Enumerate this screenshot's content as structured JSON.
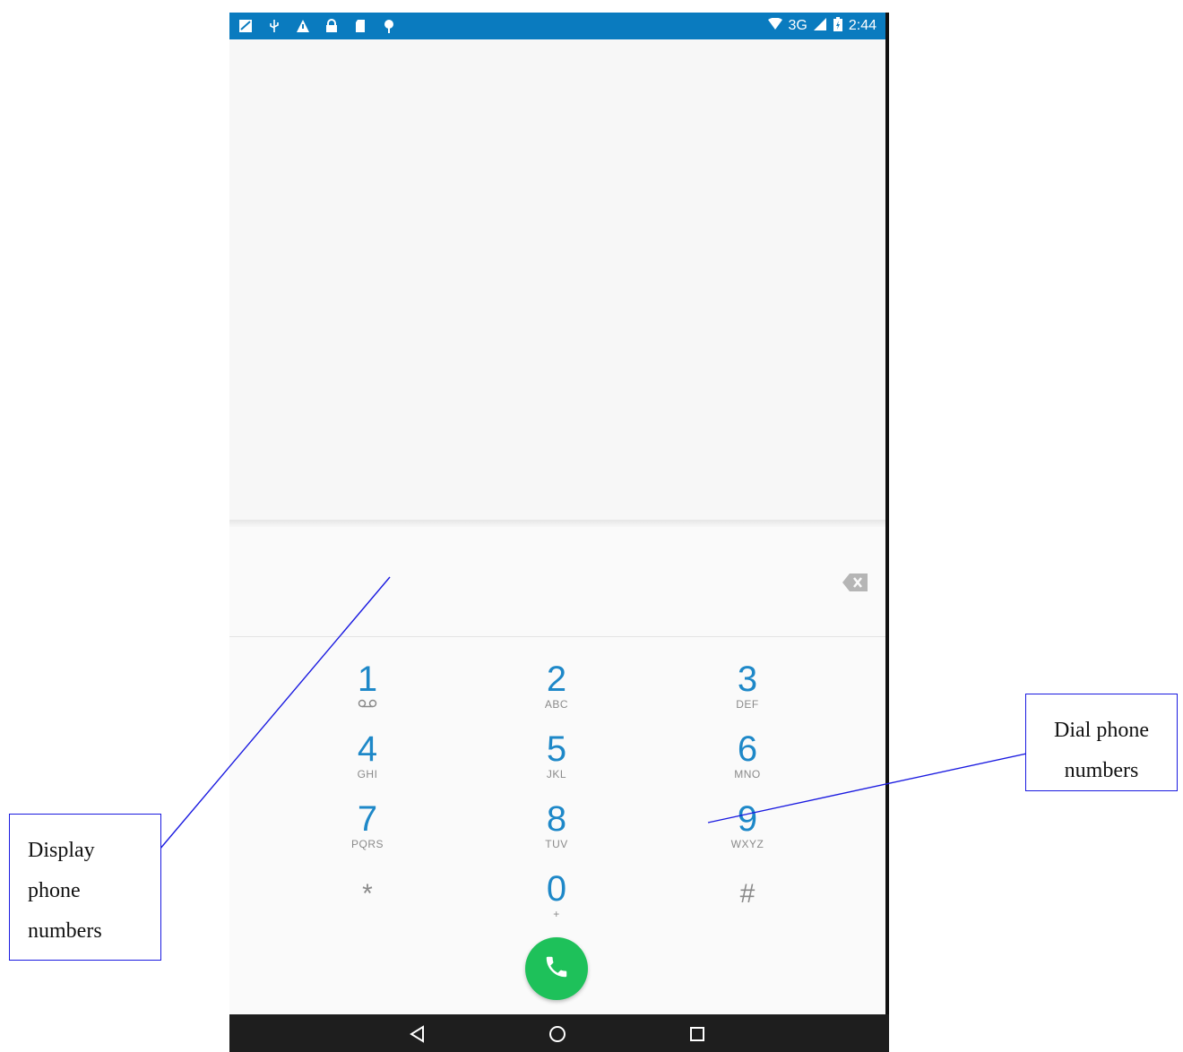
{
  "statusbar": {
    "left_icons": [
      "notification-icon",
      "usb-icon",
      "warning-icon",
      "lock-icon",
      "sd-card-icon",
      "android-debug-icon"
    ],
    "network": "3G",
    "time": "2:44"
  },
  "dialer": {
    "entered_number": "",
    "keys": [
      {
        "digit": "1",
        "letters": "ᅇ"
      },
      {
        "digit": "2",
        "letters": "ABC"
      },
      {
        "digit": "3",
        "letters": "DEF"
      },
      {
        "digit": "4",
        "letters": "GHI"
      },
      {
        "digit": "5",
        "letters": "JKL"
      },
      {
        "digit": "6",
        "letters": "MNO"
      },
      {
        "digit": "7",
        "letters": "PQRS"
      },
      {
        "digit": "8",
        "letters": "TUV"
      },
      {
        "digit": "9",
        "letters": "WXYZ"
      },
      {
        "digit": "*",
        "letters": ""
      },
      {
        "digit": "0",
        "letters": "+"
      },
      {
        "digit": "#",
        "letters": ""
      }
    ],
    "call_color": "#1ec15a"
  },
  "annotations": {
    "left": "Display\nphone\nnumbers",
    "right": "Dial phone\nnumbers"
  },
  "colors": {
    "statusbar": "#0a7bbf",
    "digit": "#1e88c8",
    "callout_border": "#1a1ae0"
  }
}
